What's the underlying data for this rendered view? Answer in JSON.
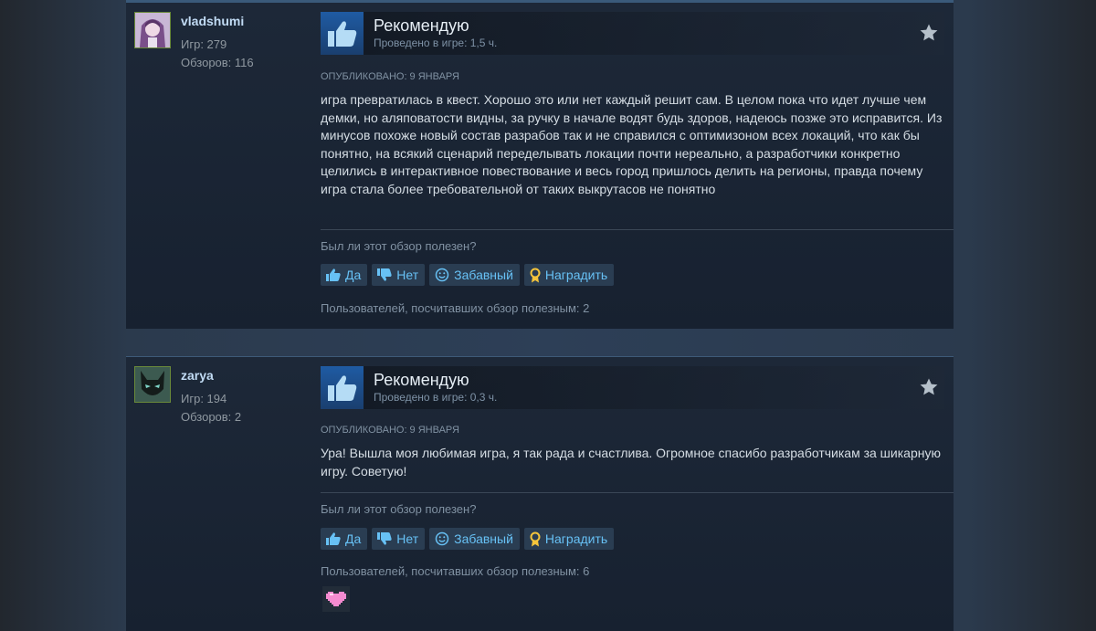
{
  "reviews": [
    {
      "author": {
        "name": "vladshumi",
        "games": "Игр: 279",
        "reviews": "Обзоров: 116"
      },
      "verdict": "Рекомендую",
      "playtime": "Проведено в игре: 1,5 ч.",
      "posted": "ОПУБЛИКОВАНО: 9 ЯНВАРЯ",
      "text": "игра превратилась в квест. Хорошо это или нет каждый решит сам. В целом пока что идет лучше чем демки, но аляповатости видны, за ручку в начале водят будь здоров, надеюсь позже это исправится. Из минусов похоже новый состав разрабов так и не справился с оптимизоном всех локаций, что как бы понятно, на всякий сценарий переделывать локации почти нереально, а разработчики конкретно целились в интерактивное повествование и весь город пришлось делить на регионы, правда почему игра стала более требовательной от таких выкрутасов не понятно",
      "helpful_question": "Был ли этот обзор полезен?",
      "buttons": {
        "yes": "Да",
        "no": "Нет",
        "funny": "Забавный",
        "award": "Наградить"
      },
      "found_helpful": "Пользователей, посчитавших обзор полезным: 2"
    },
    {
      "author": {
        "name": "zarya",
        "games": "Игр: 194",
        "reviews": "Обзоров: 2"
      },
      "verdict": "Рекомендую",
      "playtime": "Проведено в игре: 0,3 ч.",
      "posted": "ОПУБЛИКОВАНО: 9 ЯНВАРЯ",
      "text": "Ура! Вышла моя любимая игра, я так рада и счастлива. Огромное спасибо разработчикам за шикарную игру. Советую!",
      "helpful_question": "Был ли этот обзор полезен?",
      "buttons": {
        "yes": "Да",
        "no": "Нет",
        "funny": "Забавный",
        "award": "Наградить"
      },
      "found_helpful": "Пользователей, посчитавших обзор полезным: 6"
    }
  ],
  "icons": {
    "thumbs_up": "thumbs-up-icon",
    "thumbs_down": "thumbs-down-icon",
    "smiley": "smiley-icon",
    "award": "award-ribbon-icon",
    "star": "star-award-icon",
    "heart": "pixel-heart-icon"
  },
  "colors": {
    "link": "#67c1f5",
    "verdict_box": "#1f5ba3",
    "muted": "#8091a2"
  }
}
